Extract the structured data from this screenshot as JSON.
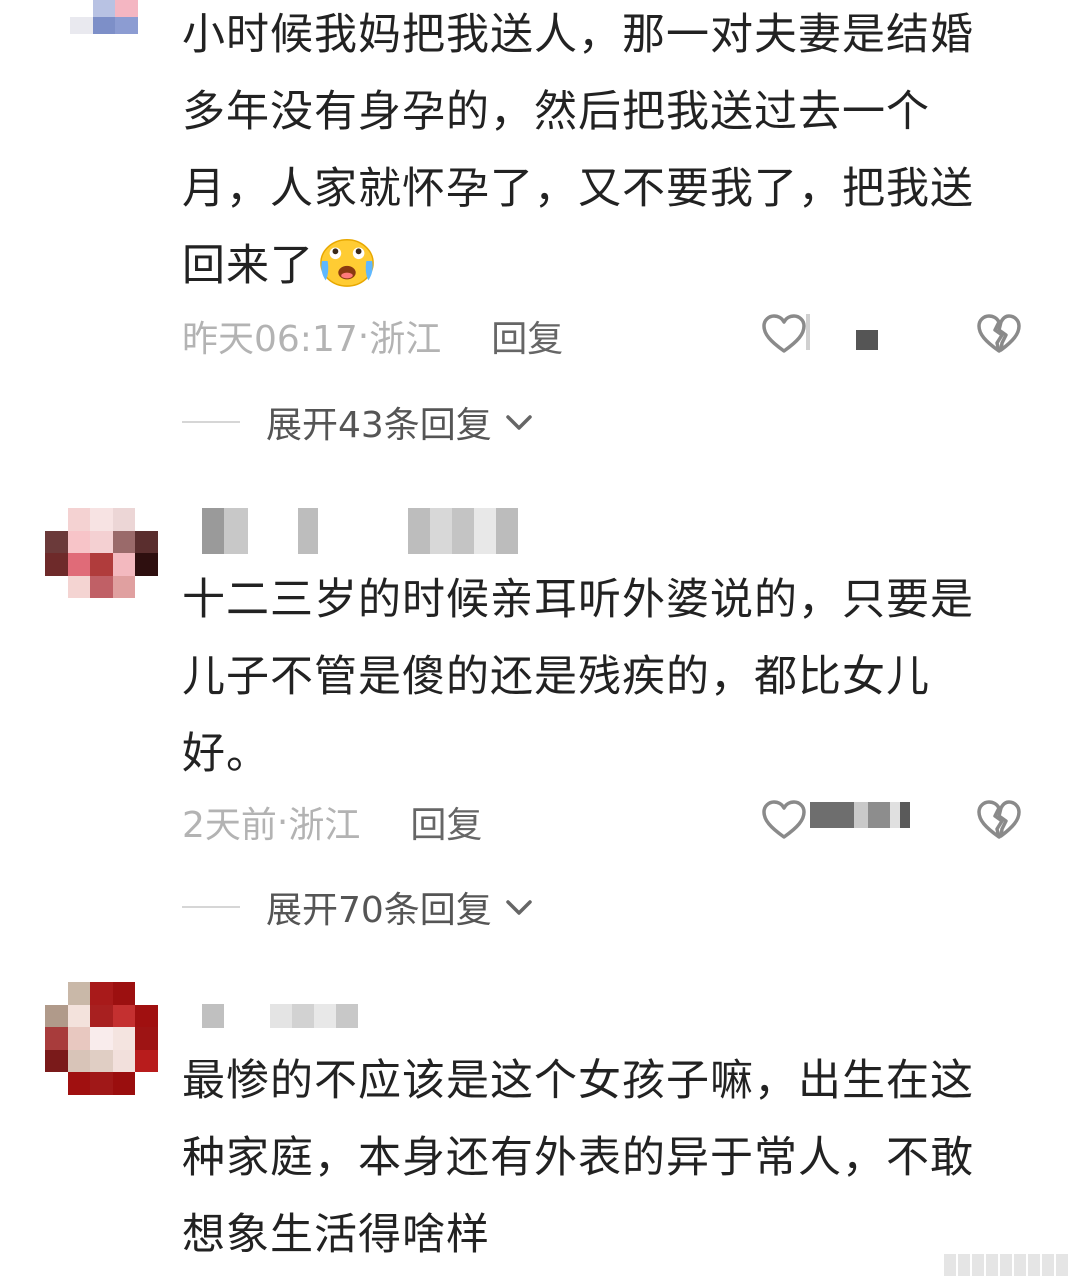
{
  "comments": [
    {
      "text_lines": [
        "小时候我妈把我送人，那一对夫妻是结婚",
        "多年没有身孕的，然后把我送过去一个",
        "月，人家就怀孕了，又不要我了，把我送",
        "回来了"
      ],
      "emoji": "crying-laughing-emoji",
      "time": "昨天06:17",
      "separator": " · ",
      "location": "浙江",
      "reply_label": "回复",
      "expand_label": "展开43条回复",
      "icons": {
        "like": "heart-outline-icon",
        "dislike": "broken-heart-icon",
        "expand": "chevron-down-icon"
      }
    },
    {
      "text_lines": [
        "十二三岁的时候亲耳听外婆说的，只要是",
        "儿子不管是傻的还是残疾的，都比女儿",
        "好。"
      ],
      "time": "2天前",
      "separator": " · ",
      "location": "浙江",
      "reply_label": "回复",
      "expand_label": "展开70条回复",
      "icons": {
        "like": "heart-outline-icon",
        "dislike": "broken-heart-icon",
        "expand": "chevron-down-icon"
      }
    },
    {
      "text_lines": [
        "最惨的不应该是这个女孩子嘛，出生在这",
        "种家庭，本身还有外表的异于常人，不敢",
        "想象生活得啥样"
      ]
    }
  ],
  "colors": {
    "text": "#222222",
    "meta": "#b3b3b3",
    "reply": "#666666",
    "icon": "#999999"
  }
}
